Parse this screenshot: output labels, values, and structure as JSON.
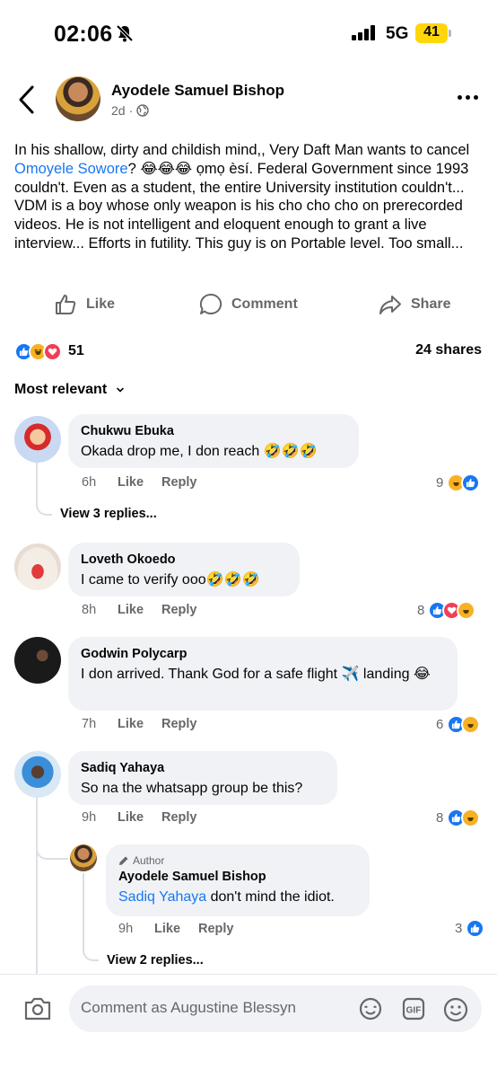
{
  "status_bar": {
    "time": "02:06",
    "network": "5G",
    "battery": "41"
  },
  "post": {
    "author": "Ayodele Samuel Bishop",
    "age": "2d",
    "body": "In his shallow, dirty and childish mind,, Very Daft Man wants to cancel ",
    "mention": "Omoyele Sowore",
    "body_after": "? 😂😂😂 ọmọ èsí. Federal Government since 1993 couldn't. Even as a student, the entire University institution couldn't... VDM is a boy whose only weapon is his cho cho cho on prerecorded videos. He is not intelligent and eloquent enough to grant a live interview... Efforts in futility.  This guy is on Portable level. Too small...",
    "actions": {
      "like": "Like",
      "comment": "Comment",
      "share": "Share"
    },
    "reaction_count": "51",
    "shares": "24 shares",
    "sort_label": "Most relevant"
  },
  "comments": [
    {
      "name": "Chukwu Ebuka",
      "text": "Okada drop me, I don reach 🤣🤣🤣",
      "time": "6h",
      "like": "Like",
      "reply": "Reply",
      "reactions": "9",
      "view_replies": "View 3 replies..."
    },
    {
      "name": "Loveth Okoedo",
      "text": "I came to verify ooo🤣🤣🤣",
      "time": "8h",
      "like": "Like",
      "reply": "Reply",
      "reactions": "8"
    },
    {
      "name": "Godwin Polycarp",
      "text": "I don arrived. Thank God for a safe flight ✈️ landing 😂",
      "time": "7h",
      "like": "Like",
      "reply": "Reply",
      "reactions": "6"
    },
    {
      "name": "Sadiq Yahaya",
      "text": "So na the whatsapp group be this?",
      "time": "9h",
      "like": "Like",
      "reply": "Reply",
      "reactions": "8"
    }
  ],
  "reply": {
    "tag": "Author",
    "name": "Ayodele Samuel Bishop",
    "mention": "Sadiq Yahaya",
    "text": " don't mind the idiot.",
    "time": "9h",
    "like": "Like",
    "reply": "Reply",
    "reactions": "3",
    "view_replies": "View 2 replies..."
  },
  "composer": {
    "placeholder": "Comment as Augustine Blessyn"
  }
}
